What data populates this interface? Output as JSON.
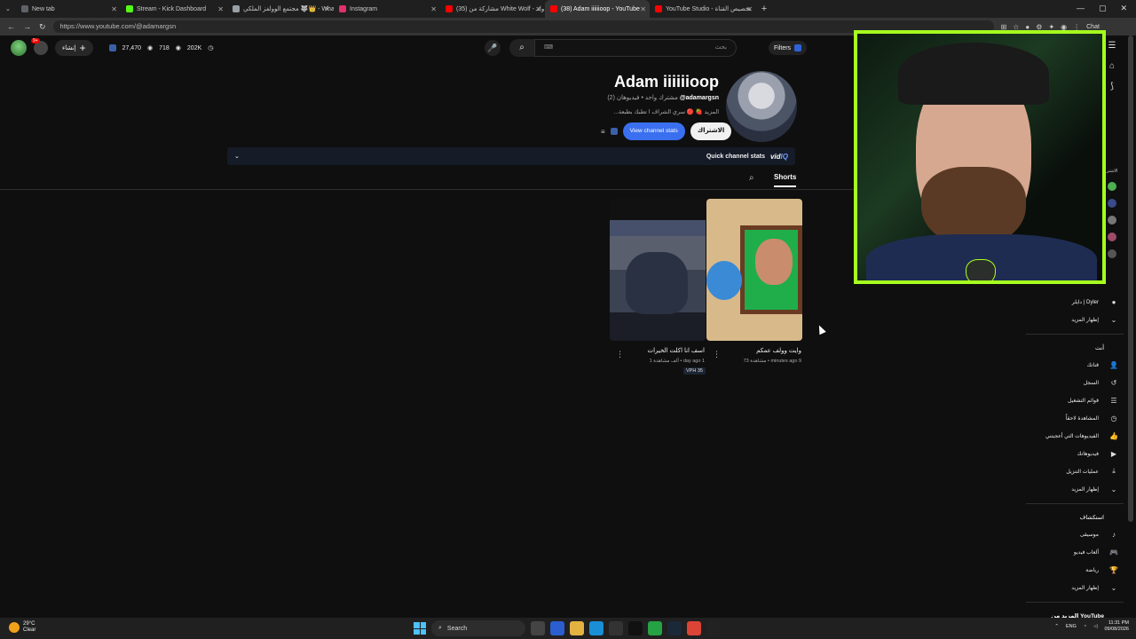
{
  "browser": {
    "tabs": [
      {
        "title": "New tab",
        "color": "#5f6368"
      },
      {
        "title": "Stream - Kick Dashboard",
        "color": "#53fc18"
      },
      {
        "title": "مجتمع الوولفز الملكي 🐺👑 - What...",
        "color": "#9aa0a6"
      },
      {
        "title": "Instagram",
        "color": "#e1306c"
      },
      {
        "title": "(35) مشاركة من White Wolf - واتـ...",
        "color": "#ff0000"
      },
      {
        "title": "(38) Adam iiiiiioop - YouTube",
        "color": "#ff0000",
        "active": true
      },
      {
        "title": "YouTube Studio - تخصيص القناة",
        "color": "#ff0000"
      }
    ],
    "url": "https://www.youtube.com/@adamargsn",
    "chat_label": "Chat"
  },
  "header": {
    "notif_count": "9+",
    "create_label": "إنشاء",
    "stats": [
      "27,470",
      "718",
      "202K"
    ],
    "search_placeholder": "بحث",
    "search_keyboard": "⌨",
    "filters_label": "Filters"
  },
  "channel": {
    "name": "Adam iiiiiioop",
    "handle": "@adamargsn",
    "meta": "مشترك واحد • فيديوهان (2)",
    "description": "...المزيد 🍓 🔴 سري الشراف ا تطبك بطبعة",
    "stats_button": "View channel stats",
    "subscribe_button": "الاشتراك"
  },
  "vidiq": {
    "label": "Quick channel stats",
    "logo_a": "vid",
    "logo_b": "IQ"
  },
  "tabs": {
    "shorts": "Shorts"
  },
  "shorts": [
    {
      "title": "اسف انا اكلت الخيرات",
      "meta": "1 ألف مشاهدة • day ago 1",
      "vph": "VPH 35"
    },
    {
      "title": "وايت وولف عمكم",
      "meta": "73 مشاهدة • minutes ago 9"
    }
  ],
  "sidebar": {
    "sub_channel": "دايلر | Dyler",
    "show_more": "إظهار المزيد",
    "you_head": "أنت",
    "you_items": [
      {
        "label": "قناتك",
        "icon": "channel-icon",
        "glyph": "👤"
      },
      {
        "label": "السجل",
        "icon": "history-icon",
        "glyph": "↺"
      },
      {
        "label": "قوائم التشغيل",
        "icon": "playlists-icon",
        "glyph": "☰"
      },
      {
        "label": "المشاهدة لاحقاً",
        "icon": "watch-later-icon",
        "glyph": "◷"
      },
      {
        "label": "الفيديوهات التي أعجبتني",
        "icon": "like-icon",
        "glyph": "👍"
      },
      {
        "label": "فيديوهاتك",
        "icon": "your-videos-icon",
        "glyph": "▶"
      },
      {
        "label": "عمليات التنزيل",
        "icon": "download-icon",
        "glyph": "⤓"
      },
      {
        "label": "إظهار المزيد",
        "icon": "chevron-down-icon",
        "glyph": "⌄"
      }
    ],
    "explore_head": "استكشاف",
    "explore_items": [
      {
        "label": "موسيقى",
        "icon": "music-icon",
        "glyph": "♪"
      },
      {
        "label": "ألعاب فيديو",
        "icon": "gaming-icon",
        "glyph": "🎮"
      },
      {
        "label": "رياضة",
        "icon": "trophy-icon",
        "glyph": "🏆"
      },
      {
        "label": "إظهار المزيد",
        "icon": "chevron-down-icon",
        "glyph": "⌄"
      }
    ],
    "more_from": "المزيد من YouTube",
    "subs_label": "الاشتر"
  },
  "taskbar": {
    "temp": "29°C",
    "weather": "Clear",
    "search": "Search",
    "lang": "ENG",
    "time": "11:31 PM",
    "date": "09/08/2026"
  },
  "colors": {
    "accent_blue": "#3a6ff0",
    "cam_border": "#a6ff1e",
    "bg": "#0f0f0f"
  }
}
